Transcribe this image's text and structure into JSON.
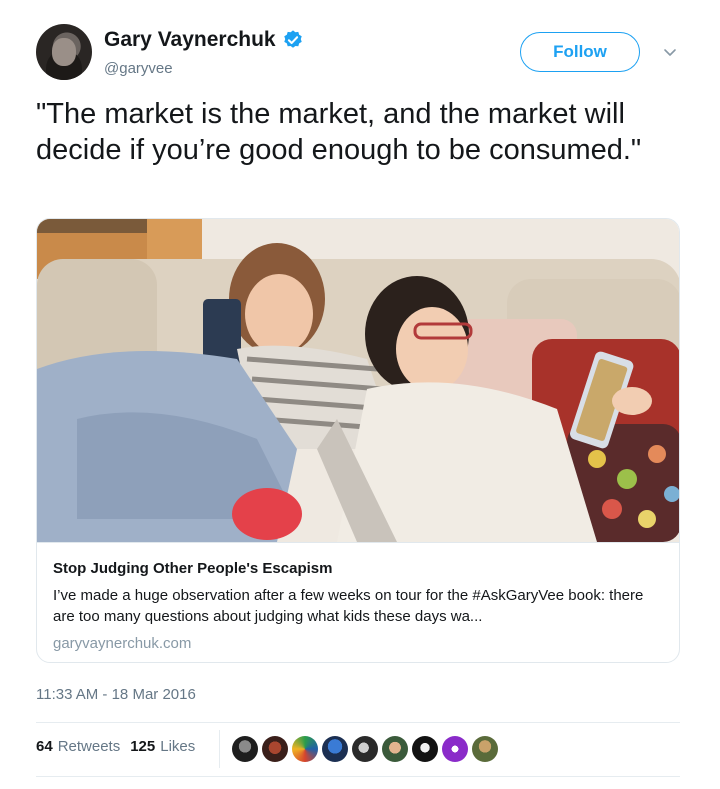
{
  "author": {
    "display_name": "Gary Vaynerchuk",
    "handle": "@garyvee",
    "avatar_icon": "user-avatar-icon",
    "verified_icon": "verified-badge-icon"
  },
  "follow_button": {
    "label": "Follow"
  },
  "menu_icon": "chevron-down-icon",
  "tweet": {
    "text": "\"The market is the market, and the market will decide if you’re good enough to be consumed.\""
  },
  "card": {
    "image_icon": "article-photo-two-girls-on-couch-with-devices",
    "title": "Stop Judging Other People's Escapism",
    "description": "I’ve made a huge observation after a few weeks on tour for the #AskGaryVee book: there are too many questions about judging what kids these days wa...",
    "domain": "garyvaynerchuk.com"
  },
  "timestamp": "11:33 AM - 18 Mar 2016",
  "stats": {
    "retweets_count": "64",
    "retweets_label": "Retweets",
    "likes_count": "125",
    "likes_label": "Likes"
  },
  "liker_avatars": [
    "liker-avatar-1",
    "liker-avatar-2",
    "liker-avatar-3",
    "liker-avatar-4",
    "liker-avatar-5",
    "liker-avatar-6",
    "liker-avatar-7",
    "liker-avatar-8",
    "liker-avatar-9"
  ],
  "colors": {
    "accent": "#1da1f2",
    "secondary_text": "#657786",
    "primary_text": "#14171a",
    "border": "#e1e8ed"
  }
}
